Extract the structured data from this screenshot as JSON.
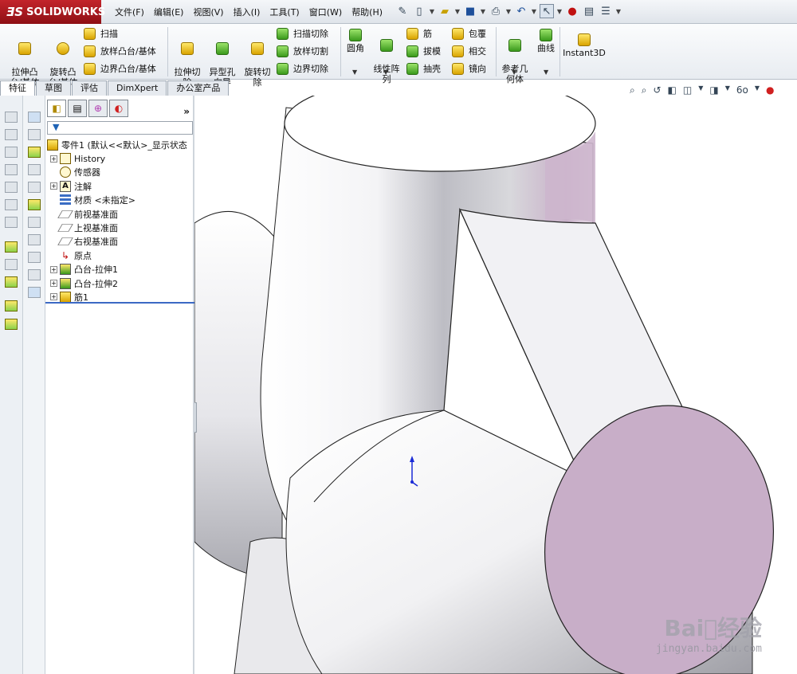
{
  "app": {
    "logo": "SOLIDWORKS"
  },
  "menu": [
    "文件(F)",
    "编辑(E)",
    "视图(V)",
    "插入(I)",
    "工具(T)",
    "窗口(W)",
    "帮助(H)"
  ],
  "commands": {
    "extrude_boss": "拉伸凸\n台/基体",
    "revolve_boss": "旋转凸\n台/基体",
    "sweep": "扫描",
    "loft_boss": "放样凸台/基体",
    "boundary_boss": "边界凸台/基体",
    "extrude_cut": "拉伸切\n除",
    "hole_wizard": "异型孔\n向导",
    "revolve_cut": "旋转切\n除",
    "sweep_cut": "扫描切除",
    "loft_cut": "放样切割",
    "boundary_cut": "边界切除",
    "fillet": "圆角",
    "linear_pattern": "线性阵\n列",
    "rib": "筋",
    "draft": "拔模",
    "shell": "抽壳",
    "wrap": "包覆",
    "intersect": "相交",
    "mirror": "镜向",
    "ref_geometry": "参考几\n何体",
    "curves": "曲线",
    "instant3d": "Instant3D"
  },
  "tabs": [
    "特征",
    "草图",
    "评估",
    "DimXpert",
    "办公室产品"
  ],
  "active_tab": 0,
  "feature_tree": {
    "root": "零件1 (默认<<默认>_显示状态",
    "items": [
      {
        "label": "History",
        "expandable": true,
        "icon": "history-icon"
      },
      {
        "label": "传感器",
        "expandable": false,
        "icon": "sensor-icon"
      },
      {
        "label": "注解",
        "expandable": true,
        "icon": "annotation-icon"
      },
      {
        "label": "材质 <未指定>",
        "expandable": false,
        "icon": "material-icon"
      },
      {
        "label": "前视基准面",
        "expandable": false,
        "icon": "plane-icon"
      },
      {
        "label": "上视基准面",
        "expandable": false,
        "icon": "plane-icon"
      },
      {
        "label": "右视基准面",
        "expandable": false,
        "icon": "plane-icon"
      },
      {
        "label": "原点",
        "expandable": false,
        "icon": "origin-icon"
      },
      {
        "label": "凸台-拉伸1",
        "expandable": true,
        "icon": "extrude-icon"
      },
      {
        "label": "凸台-拉伸2",
        "expandable": true,
        "icon": "extrude-icon"
      },
      {
        "label": "筋1",
        "expandable": true,
        "icon": "rib-icon"
      }
    ]
  },
  "watermark": {
    "brand": "Bai⃝经验",
    "url": "jingyan.baidu.com"
  },
  "colors": {
    "logo_red": "#b31b21",
    "face_pink": "#c8aec8",
    "tree_accent": "#3b69c4"
  }
}
